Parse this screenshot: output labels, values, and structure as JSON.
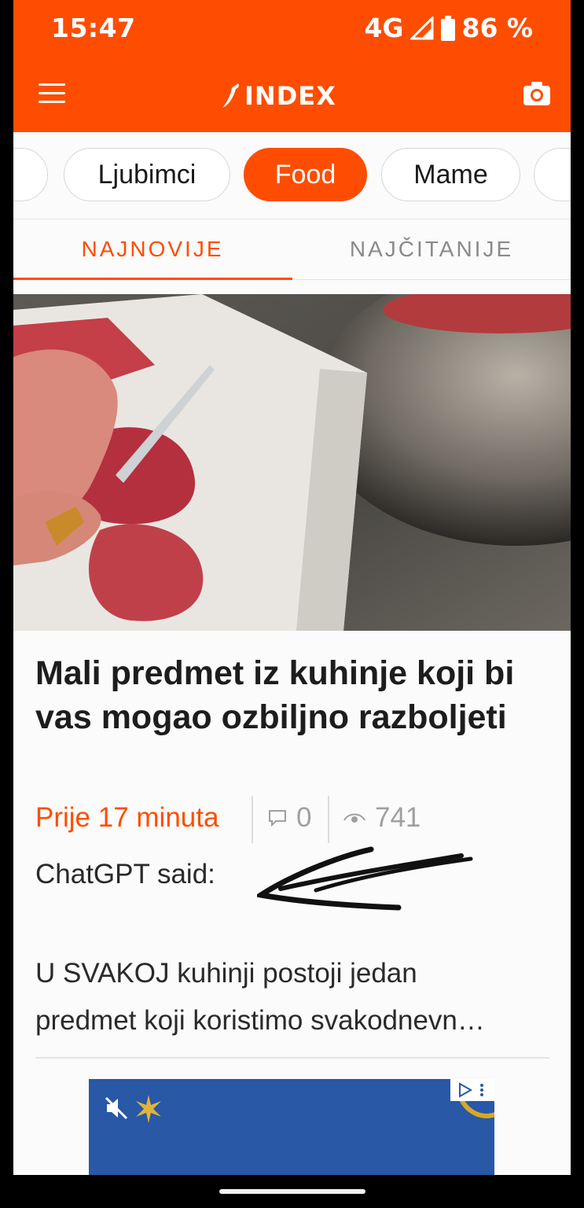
{
  "status_bar": {
    "time": "15:47",
    "network": "4G",
    "battery": "86 %"
  },
  "header": {
    "logo": "INDEX"
  },
  "categories": {
    "items": [
      "Ljubimci",
      "Food",
      "Mame"
    ],
    "active": "Food"
  },
  "tabs": [
    {
      "label": "NAJNOVIJE",
      "active": true
    },
    {
      "label": "NAJČITANIJE",
      "active": false
    }
  ],
  "article": {
    "title": "Mali predmet iz kuhinje koji bi vas mogao ozbiljno razboljeti",
    "time": "Prije 17 minuta",
    "comments": "0",
    "views": "741",
    "said": "ChatGPT said:",
    "lead_line_1": "U SVAKOJ kuhinji postoji jedan",
    "lead_line_2": "predmet koji koristimo svakodnevn…"
  },
  "colors": {
    "brand": "#fe4d00",
    "ad_background": "#2858a6"
  },
  "icons": [
    "menu-icon",
    "logo-chili-icon",
    "camera-icon",
    "comment-icon",
    "eye-icon",
    "mute-icon",
    "ad-choices-icon"
  ]
}
